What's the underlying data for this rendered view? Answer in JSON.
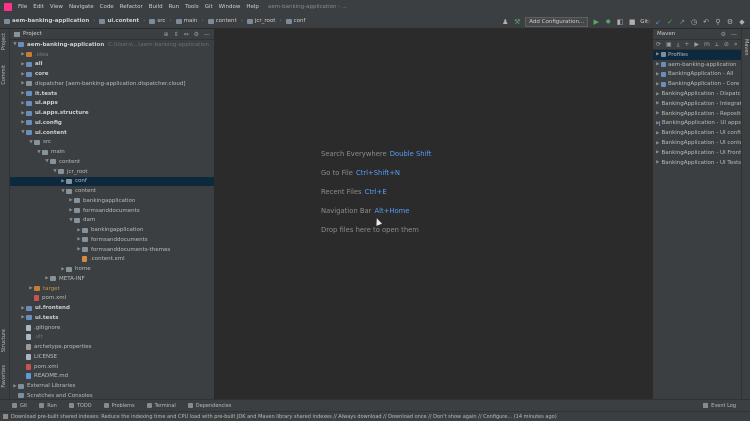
{
  "menu": {
    "items": [
      "File",
      "Edit",
      "View",
      "Navigate",
      "Code",
      "Refactor",
      "Build",
      "Run",
      "Tools",
      "Git",
      "Window",
      "Help"
    ],
    "window_title": "aem-banking-application - ..."
  },
  "breadcrumbs": [
    "aem-banking-application",
    "ui.content",
    "src",
    "main",
    "content",
    "jcr_root",
    "conf"
  ],
  "toolbar": {
    "config_label": "Add Configuration...",
    "git_label": "Git:"
  },
  "project_panel": {
    "title": "Project",
    "tree": [
      {
        "indent": 0,
        "arrow": "▼",
        "icon": "module",
        "label": "aem-banking-application",
        "path": "C:\\Users\\…\\aem-banking-application",
        "bold": true
      },
      {
        "indent": 1,
        "arrow": "▶",
        "icon": "orange",
        "label": ".idea",
        "dim": true
      },
      {
        "indent": 1,
        "arrow": "▶",
        "icon": "module",
        "label": "all",
        "bold": true
      },
      {
        "indent": 1,
        "arrow": "▶",
        "icon": "module",
        "label": "core",
        "bold": true
      },
      {
        "indent": 1,
        "arrow": "▶",
        "icon": "folder",
        "label": "dispatcher [aem-banking-application.dispatcher.cloud]"
      },
      {
        "indent": 1,
        "arrow": "▶",
        "icon": "module",
        "label": "it.tests",
        "bold": true
      },
      {
        "indent": 1,
        "arrow": "▶",
        "icon": "module",
        "label": "ui.apps",
        "bold": true
      },
      {
        "indent": 1,
        "arrow": "▶",
        "icon": "module",
        "label": "ui.apps.structure",
        "bold": true
      },
      {
        "indent": 1,
        "arrow": "▶",
        "icon": "module",
        "label": "ui.config",
        "bold": true
      },
      {
        "indent": 1,
        "arrow": "▼",
        "icon": "module",
        "label": "ui.content",
        "bold": true
      },
      {
        "indent": 2,
        "arrow": "▼",
        "icon": "folder",
        "label": "src"
      },
      {
        "indent": 3,
        "arrow": "▼",
        "icon": "folder",
        "label": "main"
      },
      {
        "indent": 4,
        "arrow": "▼",
        "icon": "folder",
        "label": "content"
      },
      {
        "indent": 5,
        "arrow": "▼",
        "icon": "folder",
        "label": "jcr_root"
      },
      {
        "indent": 6,
        "arrow": "▶",
        "icon": "folder",
        "label": "conf",
        "selected": true
      },
      {
        "indent": 6,
        "arrow": "▼",
        "icon": "folder",
        "label": "content"
      },
      {
        "indent": 7,
        "arrow": "▶",
        "icon": "folder",
        "label": "bankingapplication"
      },
      {
        "indent": 7,
        "arrow": "▶",
        "icon": "folder",
        "label": "formsanddocuments"
      },
      {
        "indent": 7,
        "arrow": "▼",
        "icon": "folder",
        "label": "dam"
      },
      {
        "indent": 8,
        "arrow": "▶",
        "icon": "folder",
        "label": "bankingapplication"
      },
      {
        "indent": 8,
        "arrow": "▶",
        "icon": "folder",
        "label": "formsanddocuments"
      },
      {
        "indent": 8,
        "arrow": "▶",
        "icon": "folder",
        "label": "formsanddocuments-themes"
      },
      {
        "indent": 8,
        "arrow": "",
        "icon": "file-xml",
        "label": ".content.xml"
      },
      {
        "indent": 6,
        "arrow": "▶",
        "icon": "folder",
        "label": "home"
      },
      {
        "indent": 4,
        "arrow": "▶",
        "icon": "folder",
        "label": "META-INF"
      },
      {
        "indent": 2,
        "arrow": "▶",
        "icon": "orange",
        "label": "target",
        "orange": true,
        "excluded": true
      },
      {
        "indent": 2,
        "arrow": "",
        "icon": "file-red",
        "label": "pom.xml"
      },
      {
        "indent": 1,
        "arrow": "▶",
        "icon": "module",
        "label": "ui.frontend",
        "bold": true
      },
      {
        "indent": 1,
        "arrow": "▶",
        "icon": "module",
        "label": "ui.tests",
        "bold": true
      },
      {
        "indent": 1,
        "arrow": "",
        "icon": "file",
        "label": ".gitignore"
      },
      {
        "indent": 1,
        "arrow": "",
        "icon": "file",
        "label": ".vlt",
        "dim": true
      },
      {
        "indent": 1,
        "arrow": "",
        "icon": "file-prop",
        "label": "archetype.properties"
      },
      {
        "indent": 1,
        "arrow": "",
        "icon": "file",
        "label": "LICENSE"
      },
      {
        "indent": 1,
        "arrow": "",
        "icon": "file-red",
        "label": "pom.xml"
      },
      {
        "indent": 1,
        "arrow": "",
        "icon": "file-md",
        "label": "README.md"
      },
      {
        "indent": 0,
        "arrow": "▶",
        "icon": "lib",
        "label": "External Libraries"
      },
      {
        "indent": 0,
        "arrow": "",
        "icon": "lib",
        "label": "Scratches and Consoles"
      }
    ]
  },
  "left_strip": {
    "tabs": [
      "Project",
      "Commit",
      "Structure",
      "Favorites"
    ]
  },
  "editor": {
    "hints": [
      {
        "label": "Search Everywhere",
        "key": "Double Shift"
      },
      {
        "label": "Go to File",
        "key": "Ctrl+Shift+N"
      },
      {
        "label": "Recent Files",
        "key": "Ctrl+E"
      },
      {
        "label": "Navigation Bar",
        "key": "Alt+Home"
      },
      {
        "label": "Drop files here to open them",
        "key": ""
      }
    ]
  },
  "maven": {
    "title": "Maven",
    "rows": [
      {
        "label": "Profiles",
        "icon": "prof",
        "selected": true
      },
      {
        "label": "aem-banking-application",
        "icon": "mod"
      },
      {
        "label": "BankingApplication - All",
        "icon": "mod"
      },
      {
        "label": "BankingApplication - Core",
        "icon": "mod"
      },
      {
        "label": "BankingApplication - Dispatcher",
        "icon": "mod"
      },
      {
        "label": "BankingApplication - Integration Tests",
        "icon": "mod"
      },
      {
        "label": "BankingApplication - Repository Structure",
        "icon": "mod"
      },
      {
        "label": "BankingApplication - UI apps",
        "icon": "mod"
      },
      {
        "label": "BankingApplication - UI config",
        "icon": "mod"
      },
      {
        "label": "BankingApplication - UI content",
        "icon": "mod"
      },
      {
        "label": "BankingApplication - UI Frontend",
        "icon": "mod"
      },
      {
        "label": "BankingApplication - UI Tests",
        "icon": "mod"
      }
    ],
    "right_tab": "Maven"
  },
  "bottom_tabs": [
    "Git",
    "Run",
    "TODO",
    "Problems",
    "Terminal",
    "Dependencies"
  ],
  "event_log": "Event Log",
  "status_message": "Download pre-built shared indexes: Reduce the indexing time and CPU load with pre-built JDK and Maven library shared indexes // Always download // Download once // Don't show again // Configure... (14 minutes ago)"
}
